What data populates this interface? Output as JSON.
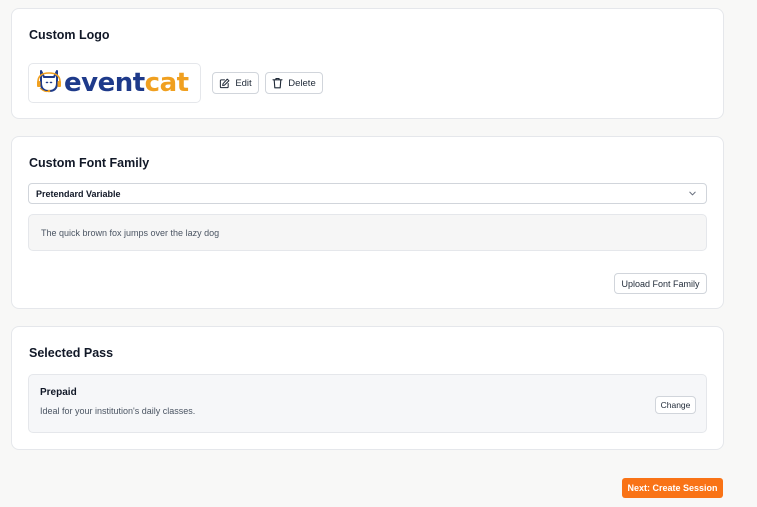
{
  "logo_section": {
    "title": "Custom Logo",
    "logo_text_primary": "event",
    "logo_text_accent": "cat",
    "logo_icon": "cat-headset-icon",
    "brand_colors": {
      "primary": "#1e3a8a",
      "accent": "#f0a020"
    },
    "edit_label": "Edit",
    "edit_icon": "pencil-square-icon",
    "delete_label": "Delete",
    "delete_icon": "trash-icon"
  },
  "font_section": {
    "title": "Custom Font Family",
    "selected_font": "Pretendard Variable",
    "select_icon": "chevron-down-icon",
    "preview_text": "The quick brown fox jumps over the lazy dog",
    "upload_label": "Upload Font Family"
  },
  "pass_section": {
    "title": "Selected Pass",
    "pass_name": "Prepaid",
    "pass_description": "Ideal for your institution's daily classes.",
    "change_label": "Change"
  },
  "footer": {
    "next_label": "Next: Create Session",
    "next_color": "#f97316"
  }
}
